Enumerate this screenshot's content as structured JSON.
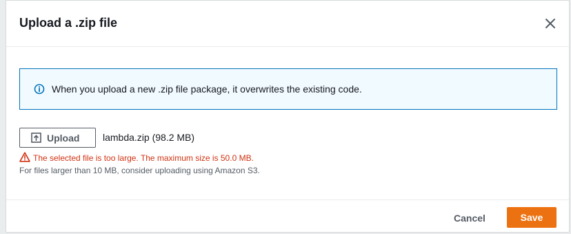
{
  "modal": {
    "title": "Upload a .zip file"
  },
  "info": {
    "message": "When you upload a new .zip file package, it overwrites the existing code."
  },
  "upload": {
    "button_label": "Upload",
    "file_name": "lambda.zip (98.2 MB)"
  },
  "validation": {
    "error": "The selected file is too large. The maximum size is 50.0 MB.",
    "hint": "For files larger than 10 MB, consider uploading using Amazon S3."
  },
  "footer": {
    "cancel_label": "Cancel",
    "save_label": "Save"
  },
  "icons": {
    "close": "close-icon",
    "info": "info-icon",
    "upload": "upload-icon",
    "error": "warning-icon"
  },
  "colors": {
    "primary_action": "#ec7211",
    "info_border": "#0073bb",
    "info_background": "#f1faff",
    "error": "#d13212"
  }
}
